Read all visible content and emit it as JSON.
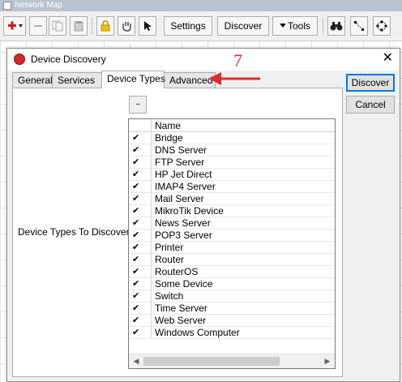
{
  "background_window": {
    "title": "Network Map",
    "toolbar": {
      "settings": "Settings",
      "discover": "Discover",
      "tools": "Tools"
    }
  },
  "dialog": {
    "title": "Device Discovery",
    "tabs": [
      "General",
      "Services",
      "Device Types",
      "Advanced"
    ],
    "active_tab": "Device Types",
    "buttons": {
      "discover": "Discover",
      "cancel": "Cancel"
    },
    "ellipsis": "...",
    "field_label": "Device Types To Discover:",
    "list": {
      "header": "Name",
      "items": [
        {
          "name": "Bridge",
          "checked": true
        },
        {
          "name": "DNS Server",
          "checked": true
        },
        {
          "name": "FTP Server",
          "checked": true
        },
        {
          "name": "HP Jet Direct",
          "checked": true
        },
        {
          "name": "IMAP4 Server",
          "checked": true
        },
        {
          "name": "Mail Server",
          "checked": true
        },
        {
          "name": "MikroTik Device",
          "checked": true
        },
        {
          "name": "News Server",
          "checked": true
        },
        {
          "name": "POP3 Server",
          "checked": true
        },
        {
          "name": "Printer",
          "checked": true
        },
        {
          "name": "Router",
          "checked": true
        },
        {
          "name": "RouterOS",
          "checked": true
        },
        {
          "name": "Some Device",
          "checked": true
        },
        {
          "name": "Switch",
          "checked": true
        },
        {
          "name": "Time Server",
          "checked": true
        },
        {
          "name": "Web Server",
          "checked": true
        },
        {
          "name": "Windows Computer",
          "checked": true
        }
      ]
    }
  },
  "annotation": {
    "number": "7",
    "color": "#d63030"
  }
}
